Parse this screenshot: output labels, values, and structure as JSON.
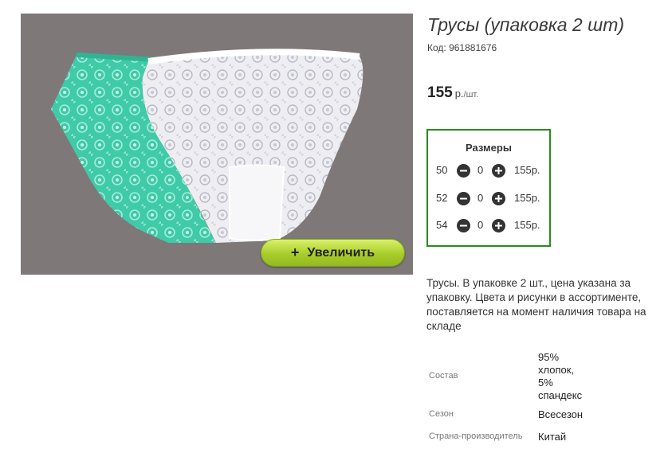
{
  "product": {
    "title": "Трусы (упаковка 2 шт)",
    "code": "Код: 961881676",
    "price_value": "155",
    "price_currency": "р.",
    "price_unit": "/шт."
  },
  "gallery": {
    "zoom_label": "Увеличить",
    "zoom_plus": "+"
  },
  "sizes": {
    "header": "Размеры",
    "rows": [
      {
        "size": "50",
        "qty": "0",
        "price": "155р."
      },
      {
        "size": "52",
        "qty": "0",
        "price": "155р."
      },
      {
        "size": "54",
        "qty": "0",
        "price": "155р."
      }
    ]
  },
  "description": "Трусы. В упаковке 2 шт., цена указана за упаковку. Цвета и рисунки в ассортименте, поставляется на момент наличия товара на складе",
  "specs": [
    {
      "label": "Состав",
      "value_lines": [
        "95%",
        "хлопок,",
        "5%",
        "спандекс"
      ]
    },
    {
      "label": "Сезон",
      "value": "Всесезон"
    },
    {
      "label": "Страна-производитель",
      "value": "Китай"
    }
  ],
  "colors": {
    "photo_background": "#7f7879",
    "garment_left": "#3fcaa8",
    "garment_right": "#f2f2f4",
    "sizes_border": "#2b8a1e",
    "zoom_button": "#a8cc2a"
  }
}
